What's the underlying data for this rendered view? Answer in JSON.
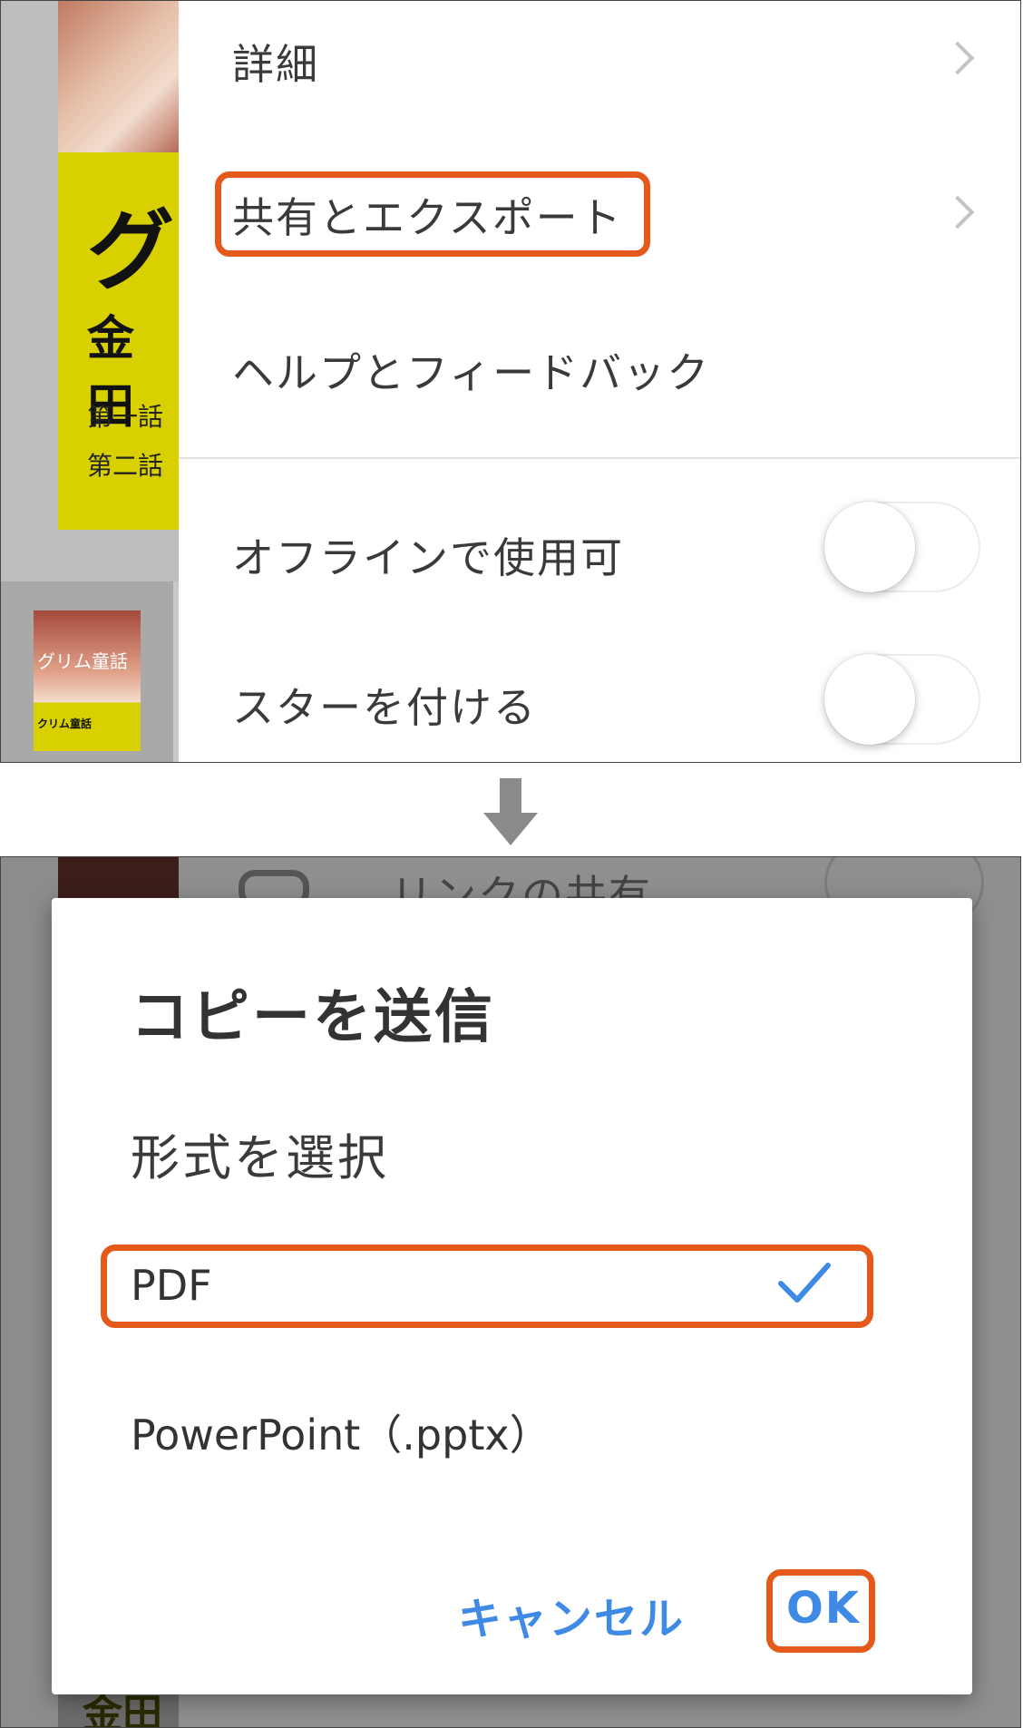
{
  "top": {
    "book": {
      "title": "グ",
      "subtitle": "金田",
      "chapters": [
        "第一話",
        "第二話"
      ],
      "thumbnail_title": "グリム童話",
      "thumbnail_subtitle": "クリム童話"
    },
    "menu": {
      "items": [
        {
          "label": "詳細"
        },
        {
          "label": "共有とエクスポート"
        },
        {
          "label": "ヘルプとフィードバック"
        }
      ],
      "toggles": [
        {
          "label": "オフラインで使用可",
          "on": false
        },
        {
          "label": "スターを付ける",
          "on": false
        }
      ]
    }
  },
  "bottom": {
    "background": {
      "link_label": "リンクの共有",
      "book_text": "金田"
    },
    "dialog": {
      "title": "コピーを送信",
      "subtitle": "形式を選択",
      "options": [
        {
          "label": "PDF",
          "selected": true
        },
        {
          "label": "PowerPoint（.pptx）",
          "selected": false
        }
      ],
      "cancel_label": "キャンセル",
      "ok_label": "OK"
    }
  },
  "colors": {
    "highlight": "#e5591a",
    "accent": "#3e8ae4",
    "book_yellow": "#d8d000"
  },
  "icons": [
    "chevron-right-icon",
    "link-icon",
    "checkmark-icon",
    "down-arrow-icon"
  ]
}
